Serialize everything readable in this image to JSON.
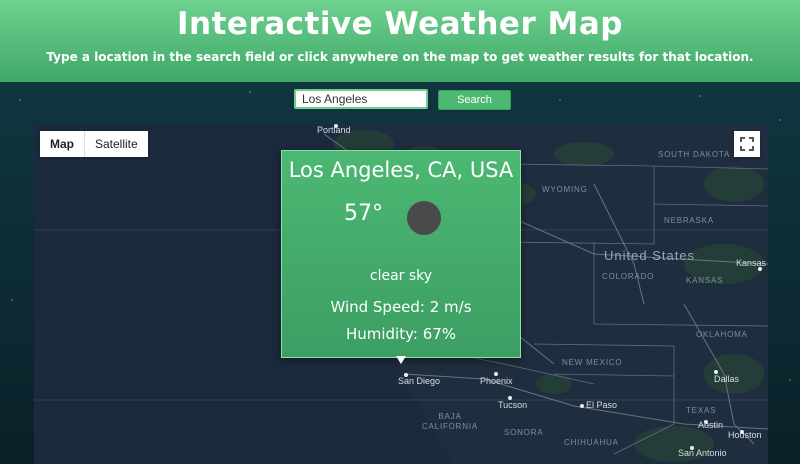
{
  "header": {
    "title": "Interactive Weather Map",
    "subtitle": "Type a location in the search field or click anywhere on the map to get weather results for that location."
  },
  "search": {
    "value": "Los Angeles",
    "button_label": "Search"
  },
  "map": {
    "type_controls": [
      "Map",
      "Satellite"
    ],
    "selected_type": "Map",
    "regions": [
      "SOUTH DAKOTA",
      "WYOMING",
      "NEBRASKA",
      "COLORADO",
      "KANSAS",
      "OKLAHOMA",
      "NEW MEXICO",
      "TEXAS",
      "BAJA CALIFORNIA",
      "SONORA",
      "CHIHUAHUA"
    ],
    "country": "United States",
    "cities": [
      "Portland",
      "Kansas",
      "San Diego",
      "Phoenix",
      "Tucson",
      "El Paso",
      "Dallas",
      "Austin",
      "Houston",
      "San Antonio"
    ]
  },
  "weather": {
    "location": "Los Angeles, CA, USA",
    "temperature": "57°",
    "description": "clear sky",
    "wind": "Wind Speed: 2 m/s",
    "humidity": "Humidity: 67%"
  },
  "colors": {
    "header_top": "#6fd18f",
    "header_bottom": "#3fa868",
    "card": "#4cb873",
    "map_bg": "#1c2a3e"
  }
}
